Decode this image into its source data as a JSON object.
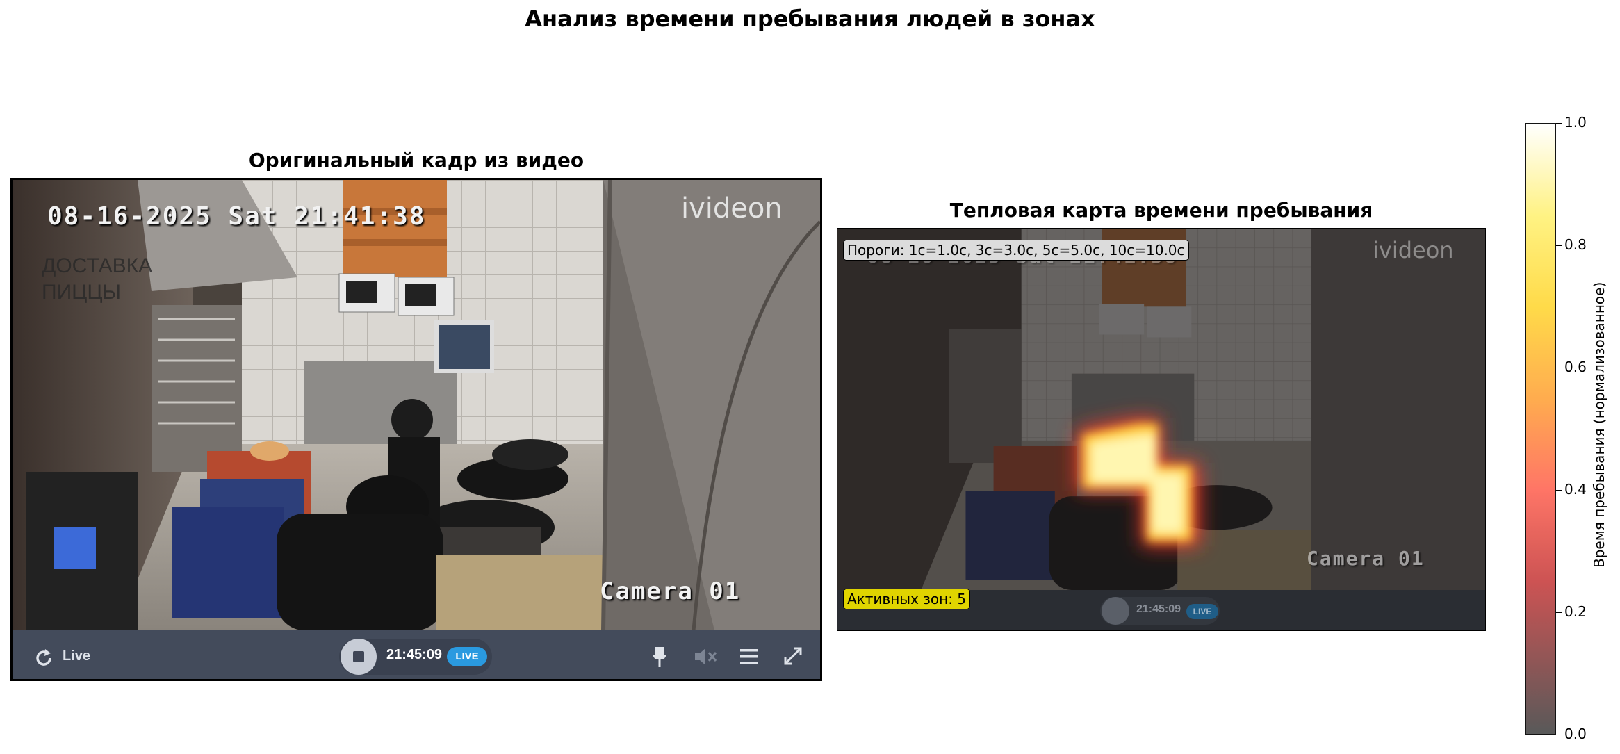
{
  "figure": {
    "title": "Анализ времени пребывания людей в зонах"
  },
  "left_panel": {
    "title": "Оригинальный кадр из видео",
    "osd_datetime": "08-16-2025 Sat 21:41:38",
    "camera_label": "Camera 01",
    "watermark": "ivideon",
    "signage": "ДОСТАВКА ПИЦЦЫ",
    "player": {
      "live_label": "Live",
      "time": "21:45:09",
      "live_badge": "LIVE",
      "icons": [
        "refresh-icon",
        "stop-icon",
        "pin-icon",
        "mute-icon",
        "menu-icon",
        "fullscreen-icon"
      ]
    }
  },
  "right_panel": {
    "title": "Тепловая карта времени пребывания",
    "thresholds_label": "Пороги: 1с=1.0с, 3с=3.0с, 5с=5.0с, 10с=10.0с",
    "active_zones_label": "Активных зон: 5",
    "osd_datetime": "08-16-2025 Sat 21:41:38",
    "camera_label": "Camera 01",
    "watermark": "ivideon",
    "player": {
      "time": "21:45:09",
      "live_badge": "LIVE"
    }
  },
  "colorbar": {
    "label": "Время пребывания (нормализованное)",
    "ticks": [
      "0.0",
      "0.2",
      "0.4",
      "0.6",
      "0.8",
      "1.0"
    ],
    "colors": [
      "#4b4b4b",
      "#c94545",
      "#ff6a5a",
      "#ffa640",
      "#ffd83a",
      "#fff27a",
      "#ffffff"
    ]
  }
}
